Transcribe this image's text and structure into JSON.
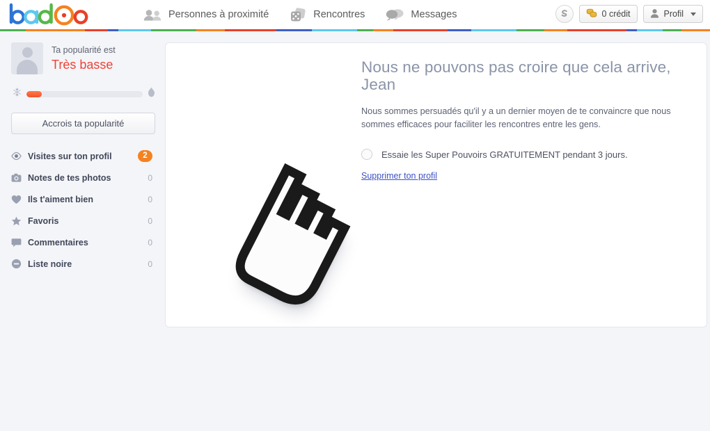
{
  "header": {
    "logo": {
      "name": "badoo-logo",
      "letters": [
        {
          "char": "b",
          "color": "#2d74d4"
        },
        {
          "char": "a",
          "color": "#5ec8ee"
        },
        {
          "char": "d",
          "color": "#57b847"
        },
        {
          "char": "O",
          "color": "#f58220"
        },
        {
          "char": "o",
          "color": "#e8402a"
        }
      ]
    },
    "nav": [
      {
        "label": "Personnes à proximité",
        "icon": "people-icon",
        "key": "people"
      },
      {
        "label": "Rencontres",
        "icon": "dice-icon",
        "key": "encounters"
      },
      {
        "label": "Messages",
        "icon": "chat-bubbles-icon",
        "key": "messages"
      }
    ],
    "super_powers_button": {
      "icon": "superpowers-s-icon",
      "label": ""
    },
    "credits_button": {
      "label": "0 crédit",
      "icon": "coins-icon"
    },
    "profile_button": {
      "label": "Profil",
      "icon": "person-icon",
      "caret": "chevron-down-icon"
    }
  },
  "stripe": {
    "colors": [
      "#4caf50",
      "#f58220",
      "#e8402a",
      "#3d5fc4",
      "#5ec8ee",
      "#4caf50",
      "#f58220",
      "#e8402a",
      "#3d5fc4",
      "#5ec8ee",
      "#4caf50",
      "#f58220",
      "#e8402a",
      "#3d5fc4",
      "#5ec8ee",
      "#4caf50",
      "#f58220",
      "#e8402a",
      "#3d5fc4",
      "#5ec8ee",
      "#4caf50",
      "#f58220"
    ]
  },
  "sidebar": {
    "popularity": {
      "label": "Ta popularité est",
      "value": "Très basse",
      "value_color": "#ef4236",
      "bar_percent": 13,
      "left_icon": "snowflake-icon",
      "right_icon": "flame-icon"
    },
    "boost_button": "Accrois ta popularité",
    "menu": [
      {
        "label": "Visites sur ton profil",
        "count": "2",
        "icon": "eye-icon",
        "badge": true
      },
      {
        "label": "Notes de tes photos",
        "count": "0",
        "icon": "camera-icon",
        "badge": false
      },
      {
        "label": "Ils t'aiment bien",
        "count": "0",
        "icon": "heart-icon",
        "badge": false
      },
      {
        "label": "Favoris",
        "count": "0",
        "icon": "star-icon",
        "badge": false
      },
      {
        "label": "Commentaires",
        "count": "0",
        "icon": "comment-icon",
        "badge": false
      },
      {
        "label": "Liste noire",
        "count": "0",
        "icon": "minus-circle-icon",
        "badge": false
      }
    ]
  },
  "main": {
    "title": "Nous ne pouvons pas croire que cela arrive, Jean",
    "body": "Nous sommes persuadés qu'il y a un dernier moyen de te convaincre que nous sommes efficaces pour faciliter les rencontres entre les gens.",
    "option_label": "Essaie les Super Pouvoirs GRATUITEMENT pendant 3 jours.",
    "delete_link": "Supprimer ton profil",
    "illustration": "pointing-hand-cursor-icon"
  },
  "colors": {
    "page_bg": "#f4f5f8",
    "panel_bg": "#ffffff",
    "accent_orange": "#f58220",
    "link_blue": "#3d52c4",
    "title_gray": "#8a94a8"
  }
}
